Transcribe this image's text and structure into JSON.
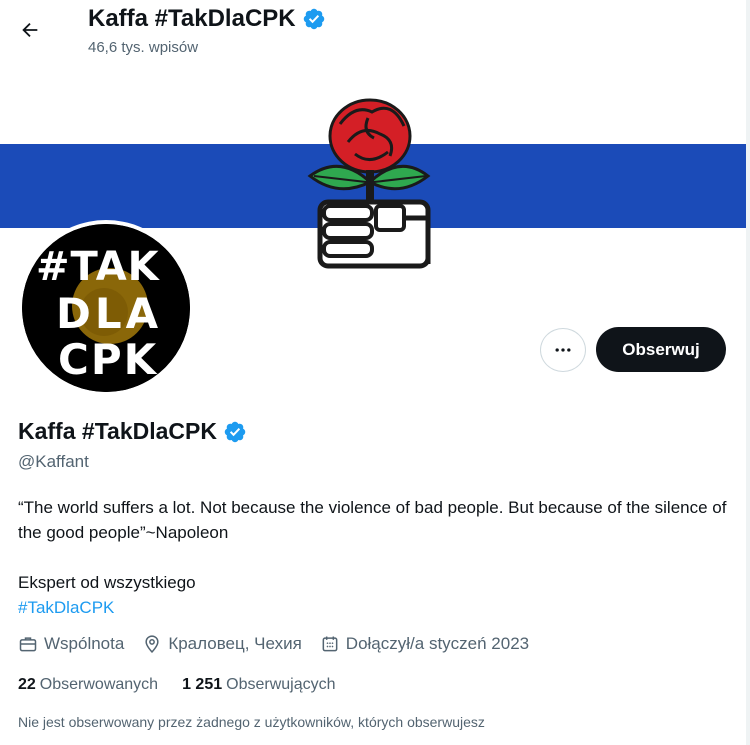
{
  "header": {
    "title": "Kaffa #TakDlaCPK",
    "post_count": "46,6 tys. wpisów"
  },
  "banner": {
    "stripe_color": "#1b4bb8",
    "emblem": "rose-and-fist-emblem"
  },
  "avatar": {
    "lines": [
      "#TAK",
      "DLA",
      "CPK"
    ]
  },
  "actions": {
    "more_icon": "more-dots-icon",
    "follow_label": "Obserwuj"
  },
  "profile": {
    "name": "Kaffa #TakDlaCPK",
    "handle": "@Kaffant",
    "bio_line1": "“The world suffers a lot. Not because the violence of bad people. But because of the silence of the good people”~Napoleon",
    "bio_line2": "Ekspert od wszystkiego",
    "bio_hashtag": "#TakDlaCPK",
    "category": "Wspólnota",
    "location": "Краловец, Чехия",
    "joined": "Dołączył/a styczeń 2023",
    "following_count": "22",
    "following_label": "Obserwowanych",
    "followers_count": "1 251",
    "followers_label": "Obserwujących",
    "mutuals_note": "Nie jest obserwowany przez żadnego z użytkowników, których obserwujesz"
  },
  "colors": {
    "verified": "#1d9bf0",
    "text": "#0f1419",
    "secondary": "#536471",
    "link": "#1d9bf0"
  }
}
